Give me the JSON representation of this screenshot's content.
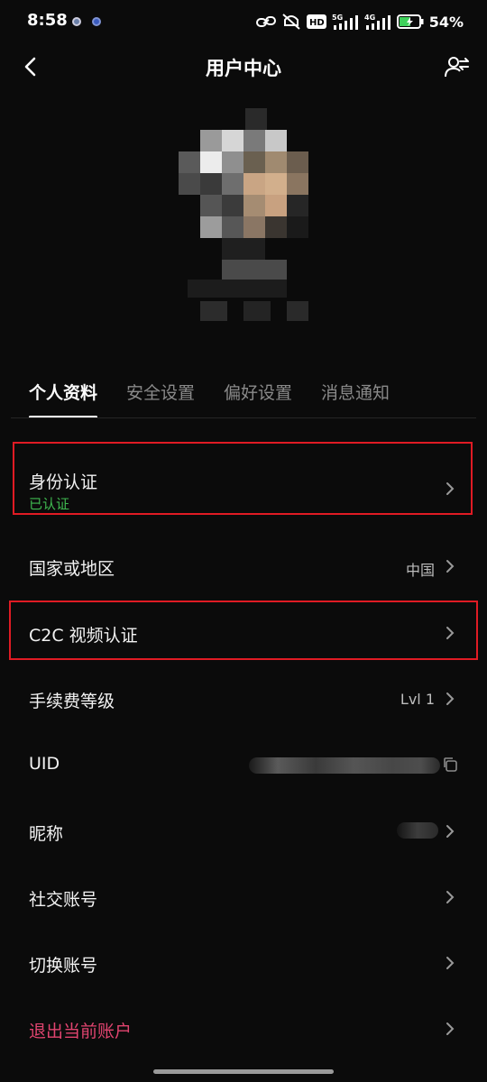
{
  "status_bar": {
    "time": "8:58",
    "battery": "54%"
  },
  "header": {
    "title": "用户中心"
  },
  "tabs": [
    {
      "label": "个人资料",
      "active": true
    },
    {
      "label": "安全设置",
      "active": false
    },
    {
      "label": "偏好设置",
      "active": false
    },
    {
      "label": "消息通知",
      "active": false
    }
  ],
  "rows": {
    "identity": {
      "label": "身份认证",
      "status": "已认证"
    },
    "region": {
      "label": "国家或地区",
      "value": "中国"
    },
    "c2c": {
      "label": "C2C 视频认证"
    },
    "fee": {
      "label": "手续费等级",
      "value": "Lvl 1"
    },
    "uid": {
      "label": "UID"
    },
    "nickname": {
      "label": "昵称"
    },
    "social": {
      "label": "社交账号"
    },
    "switch": {
      "label": "切换账号"
    },
    "logout": {
      "label": "退出当前账户"
    }
  },
  "colors": {
    "background": "#0b0b0b",
    "verified_green": "#3fb950",
    "logout_pink": "#e0446f",
    "highlight_red": "#e01b24"
  },
  "icons": [
    "back-arrow-icon",
    "user-switch-icon",
    "chevron-right-icon",
    "copy-icon"
  ]
}
